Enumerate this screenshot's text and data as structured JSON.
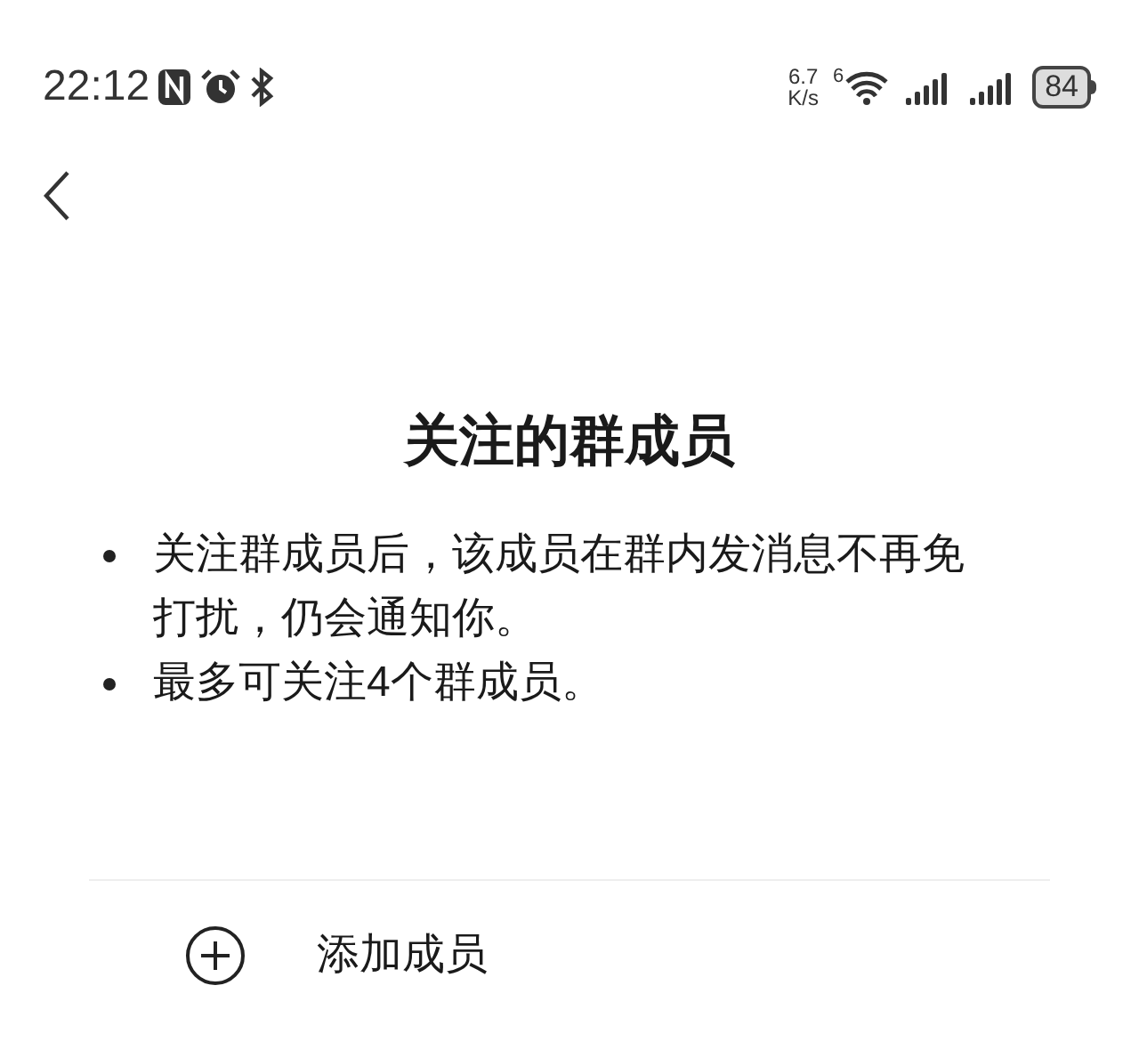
{
  "status_bar": {
    "time": "22:12",
    "speed_value": "6.7",
    "speed_unit": "K/s",
    "wifi_badge": "6",
    "battery": "84"
  },
  "title": "关注的群成员",
  "bullets": [
    "关注群成员后，该成员在群内发消息不再免打扰，仍会通知你。",
    "最多可关注4个群成员。"
  ],
  "add_button": {
    "label": "添加成员"
  }
}
